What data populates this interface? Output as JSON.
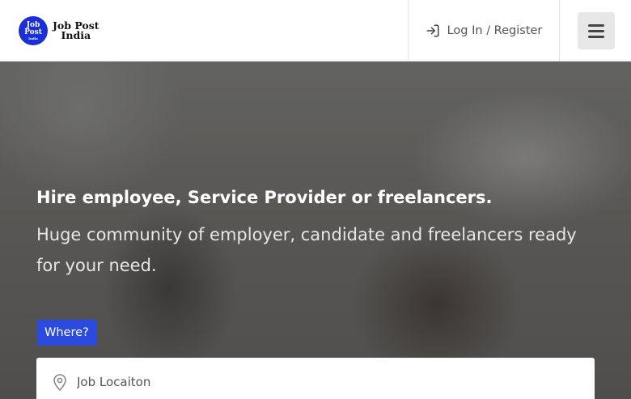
{
  "header": {
    "logo": {
      "circle_line1": "Job",
      "circle_line2": "Post",
      "circle_line3": "India",
      "text_line1": "Job Post",
      "text_line2": "India"
    },
    "login_label": "Log In / Register",
    "login_icon": "sign-in-icon",
    "menu_icon": "hamburger-menu-icon"
  },
  "hero": {
    "title": "Hire employee, Service Provider or freelancers.",
    "subtitle": "Huge community of employer, candidate and freelancers ready for your need.",
    "where_label": "Where?",
    "location_placeholder": "Job Locaiton",
    "location_value": ""
  },
  "colors": {
    "accent": "#2b4be0",
    "logo_blue": "#1a2fd6",
    "menu_button_bg": "#e7e7e7"
  }
}
